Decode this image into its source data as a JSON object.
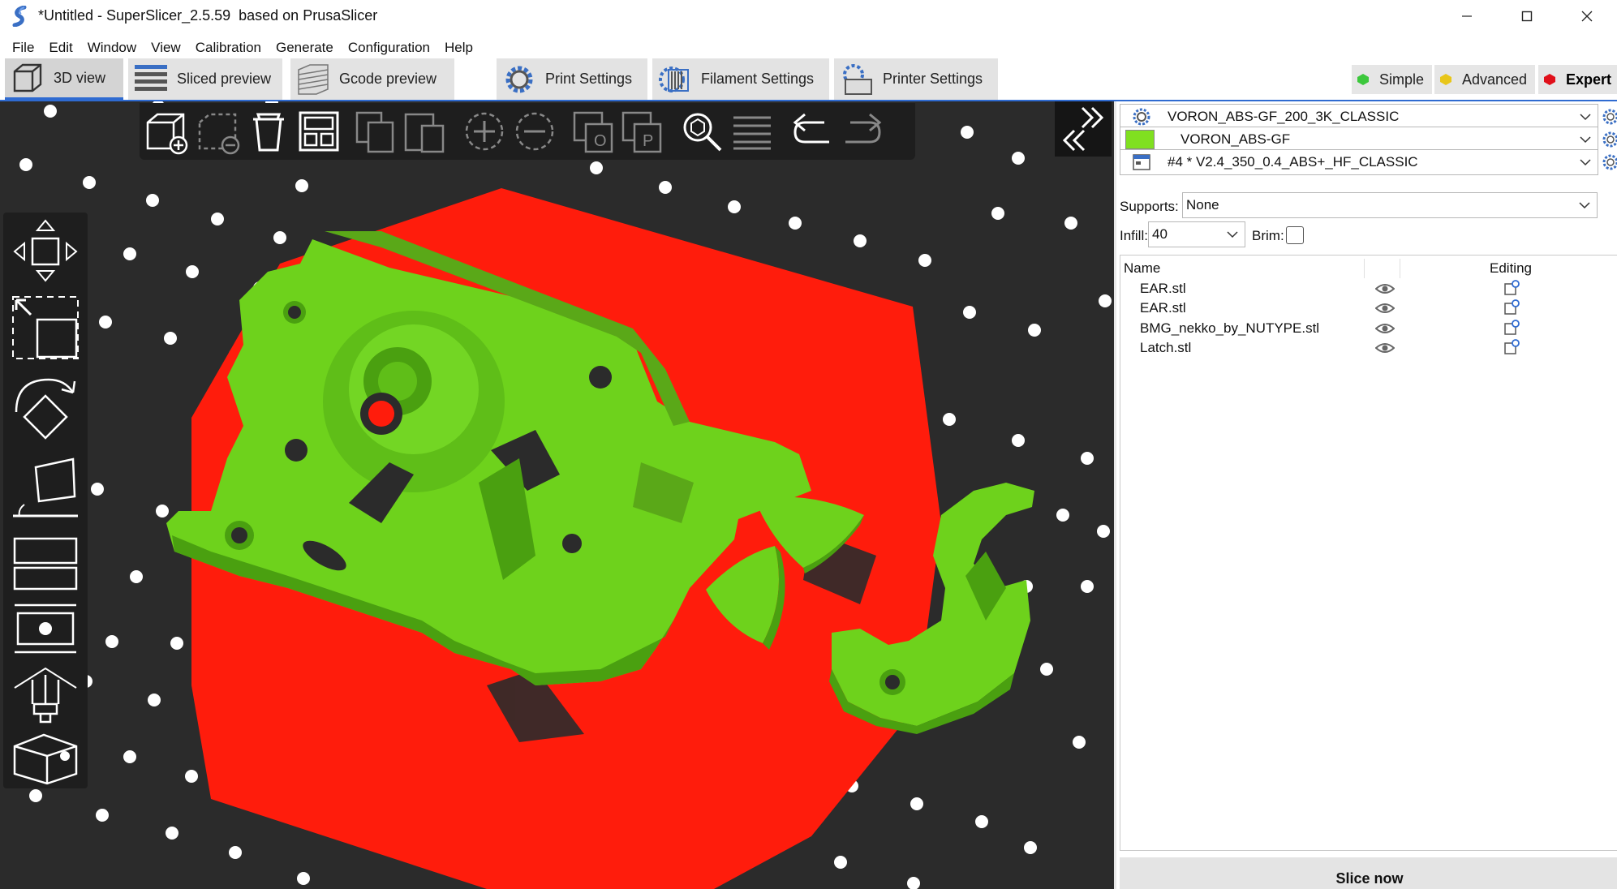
{
  "window": {
    "title": "*Untitled - SuperSlicer_2.5.59  based on PrusaSlicer",
    "controls": [
      "minimize-icon",
      "maximize-icon",
      "close-icon"
    ]
  },
  "menu": [
    "File",
    "Edit",
    "Window",
    "View",
    "Calibration",
    "Generate",
    "Configuration",
    "Help"
  ],
  "tabs": [
    {
      "label": "3D view",
      "icon": "cube-icon",
      "active": true
    },
    {
      "label": "Sliced preview",
      "icon": "sliced-layers-icon",
      "active": false
    },
    {
      "label": "Gcode preview",
      "icon": "gcode-layers-icon",
      "active": false
    },
    {
      "label": "Print Settings",
      "icon": "gear-icon",
      "active": false
    },
    {
      "label": "Filament Settings",
      "icon": "filament-spool-icon",
      "active": false
    },
    {
      "label": "Printer Settings",
      "icon": "printer-gear-icon",
      "active": false
    }
  ],
  "modes": [
    {
      "label": "Simple",
      "color": "#3cc83c"
    },
    {
      "label": "Advanced",
      "color": "#e8c61a"
    },
    {
      "label": "Expert",
      "color": "#e0101a",
      "active": true
    }
  ],
  "viewport": {
    "background": "#2b2b2b",
    "bed_color": "#ff1c0c",
    "model_color": "#6ed21c",
    "top_toolbar": [
      "add-icon",
      "delete-icon",
      "delete-all-icon",
      "arrange-icon",
      "copy-icon",
      "paste-icon",
      "add-instance-icon",
      "remove-instance-icon",
      "split-objects-icon",
      "split-parts-icon",
      "search-icon",
      "layers-editing-icon",
      "undo-icon",
      "redo-icon"
    ],
    "left_toolbar": [
      "move-icon",
      "scale-icon",
      "rotate-icon",
      "place-on-face-icon",
      "cut-icon",
      "hollow-icon",
      "paint-supports-icon",
      "seam-icon"
    ]
  },
  "sidebar": {
    "presets": {
      "print": "VORON_ABS-GF_200_3K_CLASSIC",
      "filament": "VORON_ABS-GF",
      "filament_color": "#80e020",
      "printer": "#4 * V2.4_350_0.4_ABS+_HF_CLASSIC"
    },
    "supports_label": "Supports:",
    "supports_value": "None",
    "infill_label": "Infill:",
    "infill_value": "40",
    "brim_label": "Brim:",
    "brim_checked": false,
    "objects_header": {
      "name": "Name",
      "editing": "Editing"
    },
    "objects": [
      {
        "name": "EAR.stl"
      },
      {
        "name": "EAR.stl"
      },
      {
        "name": "BMG_nekko_by_NUTYPE.stl"
      },
      {
        "name": "Latch.stl"
      }
    ],
    "slice_button": "Slice now"
  }
}
